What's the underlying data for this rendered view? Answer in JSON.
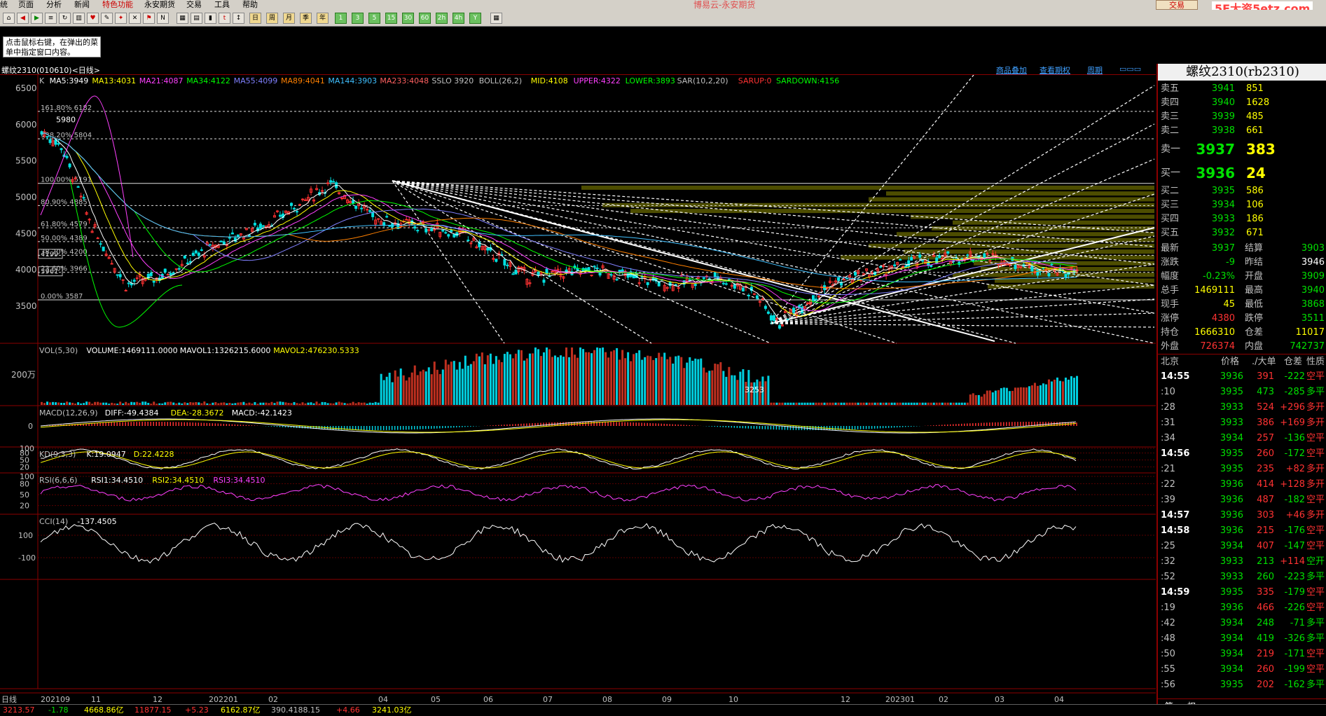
{
  "menu": [
    "统",
    "页面",
    "分析",
    "新闻",
    "特色功能",
    "永安期货",
    "交易",
    "工具",
    "帮助"
  ],
  "window_title": "博易云-永安期货",
  "trade_button": "交易",
  "watermark": "5E大资5etz.com",
  "toolbar_periods": [
    "日",
    "周",
    "月",
    "季",
    "年",
    "1",
    "3",
    "5",
    "15",
    "30",
    "60",
    "2h",
    "4h",
    "Y"
  ],
  "tip": "点击鼠标右键，在弹出的菜单中指定窗口内容。",
  "chart_header": {
    "instrument": "螺纹2310(010610)<日线>",
    "links": [
      "商品叠加",
      "查看期权",
      "周期"
    ]
  },
  "indicators": {
    "main": [
      {
        "text": "K",
        "color": "#c0c0c0"
      },
      {
        "text": "MA5:3949",
        "color": "#ffffff"
      },
      {
        "text": "MA13:4031",
        "color": "#ffff00"
      },
      {
        "text": "MA21:4087",
        "color": "#ff40ff"
      },
      {
        "text": "MA34:4122",
        "color": "#00ff00"
      },
      {
        "text": "MA55:4099",
        "color": "#8080ff"
      },
      {
        "text": "MA89:4041",
        "color": "#ff8000"
      },
      {
        "text": "MA144:3903",
        "color": "#40c0ff"
      },
      {
        "text": "MA233:4048",
        "color": "#ff6060"
      },
      {
        "text": "SSLO 3920",
        "color": "#c0c0c0"
      },
      {
        "text": "BOLL(26,2)",
        "color": "#c0c0c0"
      },
      {
        "text": "MID:4108",
        "color": "#ffff00"
      },
      {
        "text": "UPPER:4322",
        "color": "#ff40ff"
      },
      {
        "text": "LOWER:3893",
        "color": "#00ff00"
      },
      {
        "text": "SAR(10,2,20)",
        "color": "#c0c0c0"
      },
      {
        "text": "SARUP:0",
        "color": "#ff3232"
      },
      {
        "text": "SARDOWN:4156",
        "color": "#00ff00"
      }
    ],
    "vol": [
      {
        "text": "VOL(5,30)",
        "color": "#c0c0c0"
      },
      {
        "text": "VOLUME:1469111.0000",
        "color": "#ffffff"
      },
      {
        "text": "MAVOL1:1326215.6000",
        "color": "#ffffff"
      },
      {
        "text": "MAVOL2:476230.5333",
        "color": "#ffff00"
      }
    ],
    "macd": [
      {
        "text": "MACD(12,26,9)",
        "color": "#c0c0c0"
      },
      {
        "text": "DIFF:-49.4384",
        "color": "#ffffff"
      },
      {
        "text": "DEA:-28.3672",
        "color": "#ffff00"
      },
      {
        "text": "MACD:-42.1423",
        "color": "#ffffff"
      }
    ],
    "kd": [
      {
        "text": "KD(9,3,3)",
        "color": "#c0c0c0"
      },
      {
        "text": "K:19.0947",
        "color": "#ffffff"
      },
      {
        "text": "D:22.4228",
        "color": "#ffff00"
      }
    ],
    "rsi": [
      {
        "text": "RSI(6,6,6)",
        "color": "#c0c0c0"
      },
      {
        "text": "RSI1:34.4510",
        "color": "#ffffff"
      },
      {
        "text": "RSI2:34.4510",
        "color": "#ffff00"
      },
      {
        "text": "RSI3:34.4510",
        "color": "#ff40ff"
      }
    ],
    "cci": [
      {
        "text": "CCI(14)",
        "color": "#c0c0c0"
      },
      {
        "text": "-137.4505",
        "color": "#ffffff"
      }
    ]
  },
  "price_axis": [
    "6500",
    "6000",
    "5500",
    "5000",
    "4500",
    "4000",
    "3500"
  ],
  "fib_levels": [
    {
      "label": "161.80% 6182",
      "price": 6182
    },
    {
      "label": "138.20% 5804",
      "price": 5804
    },
    {
      "label": "100.00% 5191",
      "price": 5191
    },
    {
      "label": "80.90% 4885",
      "price": 4885
    },
    {
      "label": "61.80% 4579",
      "price": 4579
    },
    {
      "label": "50.00% 4389",
      "price": 4389
    },
    {
      "label": "38.20% 4200",
      "price": 4200
    },
    {
      "label": "23.60% 3966",
      "price": 3966
    },
    {
      "label": "0.00% 3587",
      "price": 3587
    }
  ],
  "price_marks": {
    "high": "5980",
    "low": "3253",
    "box1": "4199",
    "box2": "3961"
  },
  "vol_axis": [
    "200万"
  ],
  "macd_axis": [
    "0"
  ],
  "kd_axis": [
    "100",
    "80",
    "50",
    "20"
  ],
  "rsi_axis": [
    "100",
    "80",
    "50",
    "20"
  ],
  "cci_axis": [
    "100",
    "-100"
  ],
  "date_axis": [
    "日线",
    "202109",
    "11",
    "12",
    "202201",
    "02",
    "04",
    "05",
    "06",
    "07",
    "08",
    "09",
    "10",
    "12",
    "202301",
    "02",
    "03",
    "04"
  ],
  "right_panel": {
    "title": "螺纹2310(rb2310)",
    "asks": [
      {
        "label": "卖五",
        "price": "3941",
        "vol": "851"
      },
      {
        "label": "卖四",
        "price": "3940",
        "vol": "1628"
      },
      {
        "label": "卖三",
        "price": "3939",
        "vol": "485"
      },
      {
        "label": "卖二",
        "price": "3938",
        "vol": "661"
      }
    ],
    "ask1": {
      "label": "卖一",
      "price": "3937",
      "vol": "383"
    },
    "bid1": {
      "label": "买一",
      "price": "3936",
      "vol": "24"
    },
    "bids": [
      {
        "label": "买二",
        "price": "3935",
        "vol": "586"
      },
      {
        "label": "买三",
        "price": "3934",
        "vol": "106"
      },
      {
        "label": "买四",
        "price": "3933",
        "vol": "186"
      },
      {
        "label": "买五",
        "price": "3932",
        "vol": "671"
      }
    ],
    "stats": [
      {
        "l1": "最新",
        "v1": "3937",
        "c1": "#00e000",
        "l2": "结算",
        "v2": "3903",
        "c2": "#00e000"
      },
      {
        "l1": "涨跌",
        "v1": "-9",
        "c1": "#00e000",
        "l2": "昨结",
        "v2": "3946",
        "c2": "#ffffff"
      },
      {
        "l1": "幅度",
        "v1": "-0.23%",
        "c1": "#00e000",
        "l2": "开盘",
        "v2": "3909",
        "c2": "#00e000"
      },
      {
        "l1": "总手",
        "v1": "1469111",
        "c1": "#ffff00",
        "l2": "最高",
        "v2": "3940",
        "c2": "#00e000"
      },
      {
        "l1": "现手",
        "v1": "45",
        "c1": "#ffff00",
        "l2": "最低",
        "v2": "3868",
        "c2": "#00e000"
      },
      {
        "l1": "涨停",
        "v1": "4380",
        "c1": "#ff3232",
        "l2": "跌停",
        "v2": "3511",
        "c2": "#00e000"
      },
      {
        "l1": "持仓",
        "v1": "1666310",
        "c1": "#ffff00",
        "l2": "仓差",
        "v2": "11017",
        "c2": "#ffff00"
      },
      {
        "l1": "外盘",
        "v1": "726374",
        "c1": "#ff3232",
        "l2": "内盘",
        "v2": "742737",
        "c2": "#00e000"
      }
    ],
    "tick_header": [
      "北京",
      "价格",
      "./大单",
      "仓差",
      "性质"
    ],
    "ticks": [
      {
        "t": "14:55",
        "p": "3936",
        "v": "391",
        "vc": "#ff3232",
        "o": "-222",
        "oc": "#00e000",
        "ty": "空平",
        "tc": "#ff3232",
        "bold": true
      },
      {
        "t": ":10",
        "p": "3935",
        "v": "473",
        "vc": "#00e000",
        "o": "-285",
        "oc": "#00e000",
        "ty": "多平",
        "tc": "#00e000"
      },
      {
        "t": ":28",
        "p": "3933",
        "v": "524",
        "vc": "#ff3232",
        "o": "+296",
        "oc": "#ff3232",
        "ty": "多开",
        "tc": "#ff3232"
      },
      {
        "t": ":31",
        "p": "3933",
        "v": "386",
        "vc": "#ff3232",
        "o": "+169",
        "oc": "#ff3232",
        "ty": "多开",
        "tc": "#ff3232"
      },
      {
        "t": ":34",
        "p": "3934",
        "v": "257",
        "vc": "#ff3232",
        "o": "-136",
        "oc": "#00e000",
        "ty": "空平",
        "tc": "#ff3232"
      },
      {
        "t": "14:56",
        "p": "3935",
        "v": "260",
        "vc": "#ff3232",
        "o": "-172",
        "oc": "#00e000",
        "ty": "空平",
        "tc": "#ff3232",
        "bold": true
      },
      {
        "t": ":21",
        "p": "3935",
        "v": "235",
        "vc": "#ff3232",
        "o": "+82",
        "oc": "#ff3232",
        "ty": "多开",
        "tc": "#ff3232"
      },
      {
        "t": ":22",
        "p": "3936",
        "v": "414",
        "vc": "#ff3232",
        "o": "+128",
        "oc": "#ff3232",
        "ty": "多开",
        "tc": "#ff3232"
      },
      {
        "t": ":39",
        "p": "3936",
        "v": "487",
        "vc": "#ff3232",
        "o": "-182",
        "oc": "#00e000",
        "ty": "空平",
        "tc": "#ff3232"
      },
      {
        "t": "14:57",
        "p": "3936",
        "v": "303",
        "vc": "#ff3232",
        "o": "+46",
        "oc": "#ff3232",
        "ty": "多开",
        "tc": "#ff3232",
        "bold": true
      },
      {
        "t": "14:58",
        "p": "3936",
        "v": "215",
        "vc": "#ff3232",
        "o": "-176",
        "oc": "#00e000",
        "ty": "空平",
        "tc": "#ff3232",
        "bold": true
      },
      {
        "t": ":25",
        "p": "3934",
        "v": "407",
        "vc": "#ff3232",
        "o": "-147",
        "oc": "#00e000",
        "ty": "空平",
        "tc": "#ff3232"
      },
      {
        "t": ":32",
        "p": "3933",
        "v": "213",
        "vc": "#00e000",
        "o": "+114",
        "oc": "#ff3232",
        "ty": "空开",
        "tc": "#00e000"
      },
      {
        "t": ":52",
        "p": "3933",
        "v": "260",
        "vc": "#00e000",
        "o": "-223",
        "oc": "#00e000",
        "ty": "多平",
        "tc": "#00e000"
      },
      {
        "t": "14:59",
        "p": "3935",
        "v": "335",
        "vc": "#ff3232",
        "o": "-179",
        "oc": "#00e000",
        "ty": "空平",
        "tc": "#ff3232",
        "bold": true
      },
      {
        "t": ":19",
        "p": "3936",
        "v": "466",
        "vc": "#ff3232",
        "o": "-226",
        "oc": "#00e000",
        "ty": "空平",
        "tc": "#ff3232"
      },
      {
        "t": ":42",
        "p": "3934",
        "v": "248",
        "vc": "#00e000",
        "o": "-71",
        "oc": "#00e000",
        "ty": "多平",
        "tc": "#00e000"
      },
      {
        "t": ":48",
        "p": "3934",
        "v": "419",
        "vc": "#00e000",
        "o": "-326",
        "oc": "#00e000",
        "ty": "多平",
        "tc": "#00e000"
      },
      {
        "t": ":50",
        "p": "3934",
        "v": "219",
        "vc": "#ff3232",
        "o": "-171",
        "oc": "#00e000",
        "ty": "空平",
        "tc": "#ff3232"
      },
      {
        "t": ":55",
        "p": "3934",
        "v": "260",
        "vc": "#ff3232",
        "o": "-199",
        "oc": "#00e000",
        "ty": "空平",
        "tc": "#ff3232"
      },
      {
        "t": ":56",
        "p": "3935",
        "v": "202",
        "vc": "#ff3232",
        "o": "-162",
        "oc": "#00e000",
        "ty": "多平",
        "tc": "#00e000"
      }
    ],
    "tabs": [
      "笔",
      "权"
    ]
  },
  "status": [
    {
      "text": "3213.57",
      "color": "#ff3232"
    },
    {
      "text": "-1.78",
      "color": "#00e000"
    },
    {
      "text": "4668.86亿",
      "color": "#ffff00"
    },
    {
      "text": "11877.15",
      "color": "#ff3232"
    },
    {
      "text": "+5.23",
      "color": "#ff3232"
    },
    {
      "text": "6162.87亿",
      "color": "#ffff00"
    },
    {
      "text": "390.4188.15",
      "color": "#c0c0c0"
    },
    {
      "text": "+4.66",
      "color": "#ff3232"
    },
    {
      "text": "3241.03亿",
      "color": "#ffff00"
    }
  ],
  "colors": {
    "up": "#ff3232",
    "down": "#00e0e0",
    "ma5": "#ffffff",
    "ma13": "#ffff00",
    "ma21": "#ff40ff",
    "ma34": "#00ff00",
    "grid": "#8b0000"
  }
}
